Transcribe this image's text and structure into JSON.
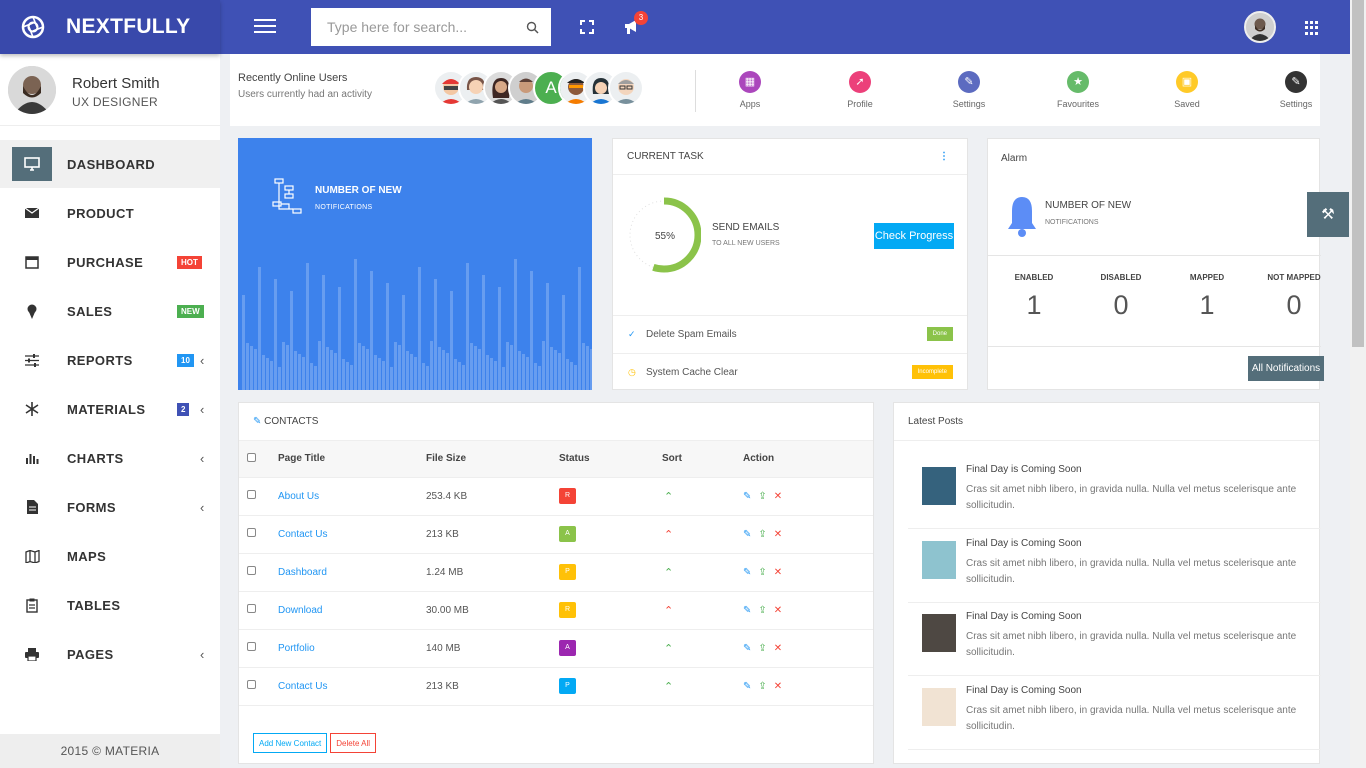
{
  "brand": {
    "name": "NEXTFULLY"
  },
  "search": {
    "placeholder": "Type here for search..."
  },
  "notifications": {
    "count": "3"
  },
  "user": {
    "name": "Robert Smith",
    "role": "UX DESIGNER"
  },
  "nav": [
    {
      "label": "DASHBOARD",
      "icon": "monitor-icon",
      "active": true
    },
    {
      "label": "PRODUCT",
      "icon": "mail-icon"
    },
    {
      "label": "PURCHASE",
      "icon": "calendar-icon",
      "tag": "HOT",
      "tag_color": "#f44336"
    },
    {
      "label": "SALES",
      "icon": "ice-cream-icon",
      "tag": "NEW",
      "tag_color": "#4caf50"
    },
    {
      "label": "REPORTS",
      "icon": "sliders-icon",
      "tag": "10",
      "tag_color": "#2196f3",
      "chevron": true
    },
    {
      "label": "MATERIALS",
      "icon": "asterisk-icon",
      "tag": "2",
      "tag_color": "#3f51b5",
      "chevron": true
    },
    {
      "label": "CHARTS",
      "icon": "bar-chart-icon",
      "chevron": true
    },
    {
      "label": "FORMS",
      "icon": "document-icon",
      "chevron": true
    },
    {
      "label": "MAPS",
      "icon": "map-icon"
    },
    {
      "label": "TABLES",
      "icon": "clipboard-icon"
    },
    {
      "label": "PAGES",
      "icon": "printer-icon",
      "chevron": true
    }
  ],
  "footer": {
    "text": "2015 © MATERIA"
  },
  "online": {
    "title": "Recently Online Users",
    "subtitle": "Users currently had an activity"
  },
  "quick_actions": [
    {
      "label": "Apps",
      "color": "#ab47bc",
      "icon": "grid-icon"
    },
    {
      "label": "Profile",
      "color": "#ec407a",
      "icon": "rocket-icon"
    },
    {
      "label": "Settings",
      "color": "#5c6bc0",
      "icon": "wrench-icon"
    },
    {
      "label": "Favourites",
      "color": "#66bb6a",
      "icon": "star-icon"
    },
    {
      "label": "Saved",
      "color": "#ffca28",
      "icon": "lock-icon"
    },
    {
      "label": "Settings",
      "color": "#333333",
      "icon": "gear-icon"
    }
  ],
  "notif_card": {
    "title": "NUMBER OF NEW",
    "subtitle": "NOTIFICATIONS"
  },
  "current_task": {
    "title": "CURRENT TASK",
    "percent": 55,
    "percent_label": "55%",
    "task": "SEND EMAILS",
    "task_sub": "TO ALL NEW USERS",
    "button": "Check Progress",
    "items": [
      {
        "text": "Delete Spam Emails",
        "status": "Done",
        "color": "#8bc34a",
        "icon": "check-icon",
        "icon_color": "#2196f3"
      },
      {
        "text": "System Cache Clear",
        "status": "Incomplete",
        "color": "#ffc107",
        "icon": "clock-icon",
        "icon_color": "#ffc107"
      }
    ]
  },
  "alarm": {
    "title": "Alarm",
    "count_title": "NUMBER OF NEW",
    "count_sub": "NOTIFICATIONS",
    "stats": [
      {
        "label": "ENABLED",
        "value": "1"
      },
      {
        "label": "DISABLED",
        "value": "0"
      },
      {
        "label": "MAPPED",
        "value": "1"
      },
      {
        "label": "NOT MAPPED",
        "value": "0"
      }
    ],
    "button": "All Notifications"
  },
  "contacts": {
    "title": "CONTACTS",
    "headers": [
      "Page Title",
      "File Size",
      "Status",
      "Sort",
      "Action"
    ],
    "rows": [
      {
        "title": "About Us",
        "size": "253.4 KB",
        "status": "R",
        "color": "#f44336",
        "sort": "up"
      },
      {
        "title": "Contact Us",
        "size": "213 KB",
        "status": "A",
        "color": "#8bc34a",
        "sort": "down"
      },
      {
        "title": "Dashboard",
        "size": "1.24 MB",
        "status": "P",
        "color": "#ffc107",
        "sort": "up"
      },
      {
        "title": "Download",
        "size": "30.00 MB",
        "status": "R",
        "color": "#ffc107",
        "sort": "down"
      },
      {
        "title": "Portfolio",
        "size": "140 MB",
        "status": "A",
        "color": "#9c27b0",
        "sort": "up"
      },
      {
        "title": "Contact Us",
        "size": "213 KB",
        "status": "P",
        "color": "#03a9f4",
        "sort": "up"
      }
    ],
    "add_button": "Add New Contact",
    "delete_button": "Delete All"
  },
  "posts": {
    "title": "Latest Posts",
    "items": [
      {
        "title": "Final Day is Coming Soon",
        "desc": "Cras sit amet nibh libero, in gravida nulla. Nulla vel metus scelerisque ante sollicitudin.",
        "thumb": "#35627d"
      },
      {
        "title": "Final Day is Coming Soon",
        "desc": "Cras sit amet nibh libero, in gravida nulla. Nulla vel metus scelerisque ante sollicitudin.",
        "thumb": "#8ec3cf"
      },
      {
        "title": "Final Day is Coming Soon",
        "desc": "Cras sit amet nibh libero, in gravida nulla. Nulla vel metus scelerisque ante sollicitudin.",
        "thumb": "#4e4843"
      },
      {
        "title": "Final Day is Coming Soon",
        "desc": "Cras sit amet nibh libero, in gravida nulla. Nulla vel metus scelerisque ante sollicitudin.",
        "thumb": "#f1e3d3"
      }
    ]
  }
}
